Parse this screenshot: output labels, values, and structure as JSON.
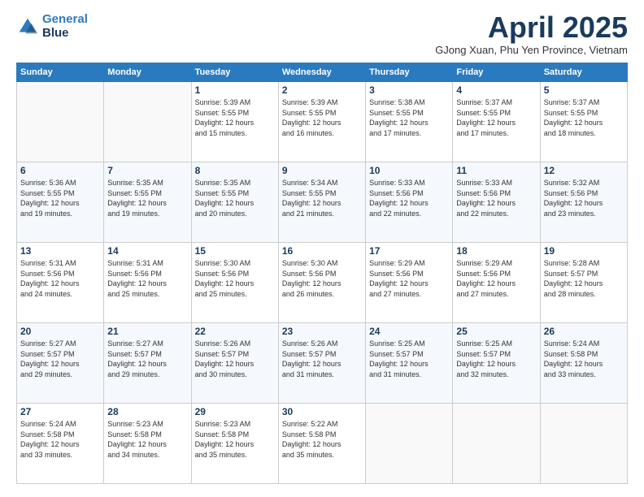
{
  "header": {
    "logo_line1": "General",
    "logo_line2": "Blue",
    "month_title": "April 2025",
    "location": "GJong Xuan, Phu Yen Province, Vietnam"
  },
  "weekdays": [
    "Sunday",
    "Monday",
    "Tuesday",
    "Wednesday",
    "Thursday",
    "Friday",
    "Saturday"
  ],
  "weeks": [
    [
      {
        "day": "",
        "info": ""
      },
      {
        "day": "",
        "info": ""
      },
      {
        "day": "1",
        "info": "Sunrise: 5:39 AM\nSunset: 5:55 PM\nDaylight: 12 hours\nand 15 minutes."
      },
      {
        "day": "2",
        "info": "Sunrise: 5:39 AM\nSunset: 5:55 PM\nDaylight: 12 hours\nand 16 minutes."
      },
      {
        "day": "3",
        "info": "Sunrise: 5:38 AM\nSunset: 5:55 PM\nDaylight: 12 hours\nand 17 minutes."
      },
      {
        "day": "4",
        "info": "Sunrise: 5:37 AM\nSunset: 5:55 PM\nDaylight: 12 hours\nand 17 minutes."
      },
      {
        "day": "5",
        "info": "Sunrise: 5:37 AM\nSunset: 5:55 PM\nDaylight: 12 hours\nand 18 minutes."
      }
    ],
    [
      {
        "day": "6",
        "info": "Sunrise: 5:36 AM\nSunset: 5:55 PM\nDaylight: 12 hours\nand 19 minutes."
      },
      {
        "day": "7",
        "info": "Sunrise: 5:35 AM\nSunset: 5:55 PM\nDaylight: 12 hours\nand 19 minutes."
      },
      {
        "day": "8",
        "info": "Sunrise: 5:35 AM\nSunset: 5:55 PM\nDaylight: 12 hours\nand 20 minutes."
      },
      {
        "day": "9",
        "info": "Sunrise: 5:34 AM\nSunset: 5:55 PM\nDaylight: 12 hours\nand 21 minutes."
      },
      {
        "day": "10",
        "info": "Sunrise: 5:33 AM\nSunset: 5:56 PM\nDaylight: 12 hours\nand 22 minutes."
      },
      {
        "day": "11",
        "info": "Sunrise: 5:33 AM\nSunset: 5:56 PM\nDaylight: 12 hours\nand 22 minutes."
      },
      {
        "day": "12",
        "info": "Sunrise: 5:32 AM\nSunset: 5:56 PM\nDaylight: 12 hours\nand 23 minutes."
      }
    ],
    [
      {
        "day": "13",
        "info": "Sunrise: 5:31 AM\nSunset: 5:56 PM\nDaylight: 12 hours\nand 24 minutes."
      },
      {
        "day": "14",
        "info": "Sunrise: 5:31 AM\nSunset: 5:56 PM\nDaylight: 12 hours\nand 25 minutes."
      },
      {
        "day": "15",
        "info": "Sunrise: 5:30 AM\nSunset: 5:56 PM\nDaylight: 12 hours\nand 25 minutes."
      },
      {
        "day": "16",
        "info": "Sunrise: 5:30 AM\nSunset: 5:56 PM\nDaylight: 12 hours\nand 26 minutes."
      },
      {
        "day": "17",
        "info": "Sunrise: 5:29 AM\nSunset: 5:56 PM\nDaylight: 12 hours\nand 27 minutes."
      },
      {
        "day": "18",
        "info": "Sunrise: 5:29 AM\nSunset: 5:56 PM\nDaylight: 12 hours\nand 27 minutes."
      },
      {
        "day": "19",
        "info": "Sunrise: 5:28 AM\nSunset: 5:57 PM\nDaylight: 12 hours\nand 28 minutes."
      }
    ],
    [
      {
        "day": "20",
        "info": "Sunrise: 5:27 AM\nSunset: 5:57 PM\nDaylight: 12 hours\nand 29 minutes."
      },
      {
        "day": "21",
        "info": "Sunrise: 5:27 AM\nSunset: 5:57 PM\nDaylight: 12 hours\nand 29 minutes."
      },
      {
        "day": "22",
        "info": "Sunrise: 5:26 AM\nSunset: 5:57 PM\nDaylight: 12 hours\nand 30 minutes."
      },
      {
        "day": "23",
        "info": "Sunrise: 5:26 AM\nSunset: 5:57 PM\nDaylight: 12 hours\nand 31 minutes."
      },
      {
        "day": "24",
        "info": "Sunrise: 5:25 AM\nSunset: 5:57 PM\nDaylight: 12 hours\nand 31 minutes."
      },
      {
        "day": "25",
        "info": "Sunrise: 5:25 AM\nSunset: 5:57 PM\nDaylight: 12 hours\nand 32 minutes."
      },
      {
        "day": "26",
        "info": "Sunrise: 5:24 AM\nSunset: 5:58 PM\nDaylight: 12 hours\nand 33 minutes."
      }
    ],
    [
      {
        "day": "27",
        "info": "Sunrise: 5:24 AM\nSunset: 5:58 PM\nDaylight: 12 hours\nand 33 minutes."
      },
      {
        "day": "28",
        "info": "Sunrise: 5:23 AM\nSunset: 5:58 PM\nDaylight: 12 hours\nand 34 minutes."
      },
      {
        "day": "29",
        "info": "Sunrise: 5:23 AM\nSunset: 5:58 PM\nDaylight: 12 hours\nand 35 minutes."
      },
      {
        "day": "30",
        "info": "Sunrise: 5:22 AM\nSunset: 5:58 PM\nDaylight: 12 hours\nand 35 minutes."
      },
      {
        "day": "",
        "info": ""
      },
      {
        "day": "",
        "info": ""
      },
      {
        "day": "",
        "info": ""
      }
    ]
  ]
}
